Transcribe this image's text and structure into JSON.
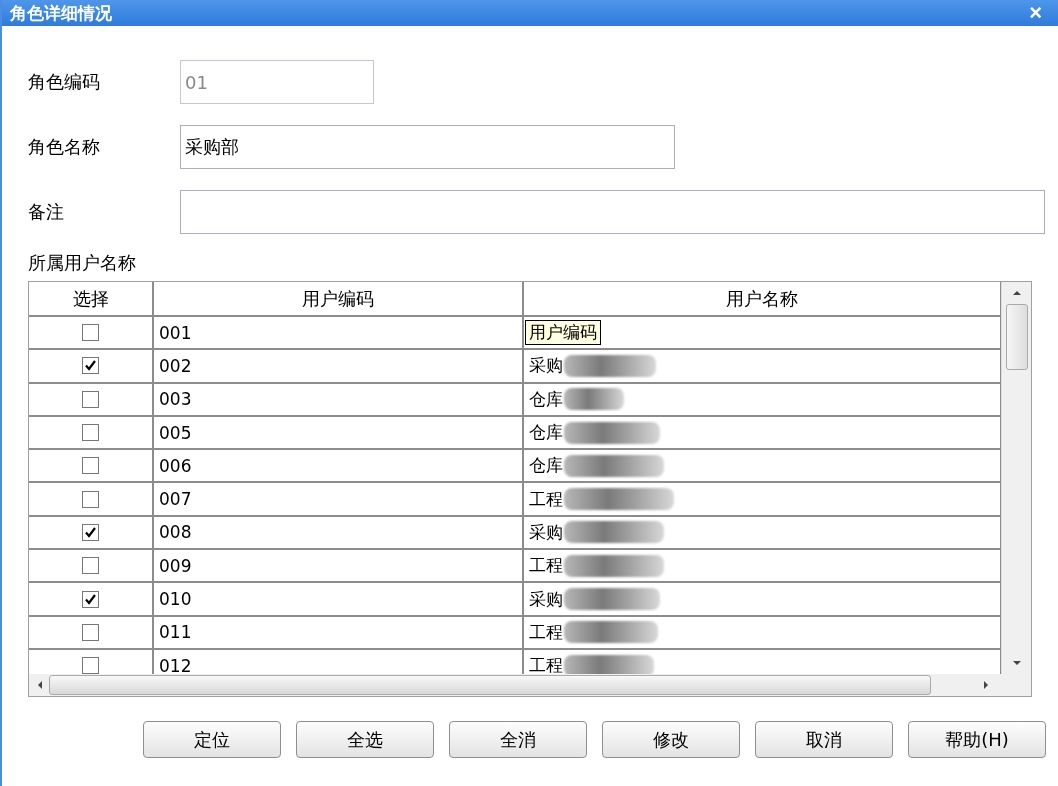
{
  "window": {
    "title": "角色详细情况",
    "close": "×"
  },
  "fields": [
    {
      "label": "角色编码",
      "value": "01",
      "disabled": true
    },
    {
      "label": "角色名称",
      "value": "采购部",
      "disabled": false
    },
    {
      "label": "备注",
      "disabled": false
    }
  ],
  "section_label": "所属用户名称",
  "table": {
    "columns": [
      "选择",
      "用户编码",
      "用户名称"
    ],
    "rows": [
      {
        "checked": false,
        "code": "001",
        "tooltip": "用户编码"
      },
      {
        "checked": true,
        "code": "002",
        "name": "采购"
      },
      {
        "checked": false,
        "code": "003",
        "name": "仓库"
      },
      {
        "checked": false,
        "code": "005",
        "name": "仓库"
      },
      {
        "checked": false,
        "code": "006",
        "name": "仓库"
      },
      {
        "checked": false,
        "code": "007",
        "name": "工程"
      },
      {
        "checked": true,
        "code": "008",
        "name": "采购"
      },
      {
        "checked": false,
        "code": "009",
        "name": "工程"
      },
      {
        "checked": true,
        "code": "010",
        "name": "采购"
      },
      {
        "checked": false,
        "code": "011",
        "name": "工程"
      },
      {
        "checked": false,
        "code": "012",
        "name": "工程"
      }
    ]
  },
  "buttons": [
    "定位",
    "全选",
    "全消",
    "修改",
    "取消",
    "帮助(H)"
  ]
}
